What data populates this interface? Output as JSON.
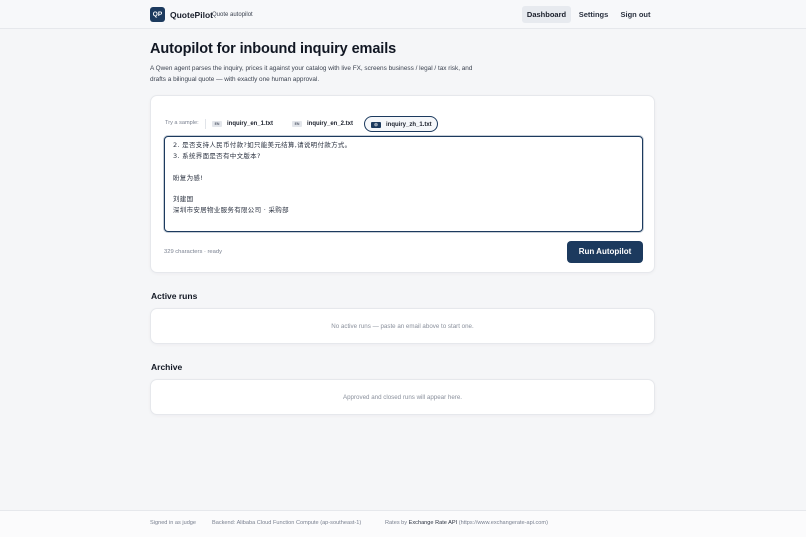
{
  "header": {
    "logo_text": "QP",
    "brand": "QuotePilot",
    "brand_sub": "Quote autopilot",
    "nav": [
      "Dashboard",
      "Settings",
      "Sign out"
    ]
  },
  "hero": {
    "title": "Autopilot for inbound inquiry emails",
    "description": "A Qwen agent parses the inquiry, prices it against your catalog with live FX, screens business / legal / tax risk, and drafts a bilingual quote — with exactly one human approval."
  },
  "composer": {
    "try_label": "Try a sample:",
    "samples": [
      {
        "flag": "EN",
        "name": "inquiry_en_1.txt"
      },
      {
        "flag": "EN",
        "name": "inquiry_en_2.txt"
      },
      {
        "flag": "中",
        "name": "inquiry_zh_1.txt"
      }
    ],
    "editor_lines": [
      "2. 是否支持人民币付款?如只能美元结算,请说明付款方式。",
      "3. 系统界面是否有中文版本?",
      "盼复为感!",
      "刘建国",
      "深圳市安居物业服务有限公司 · 采购部"
    ],
    "char_count": "329 characters · ready",
    "run_label": "Run Autopilot"
  },
  "active": {
    "title": "Active runs",
    "empty": "No active runs — paste an email above to start one."
  },
  "archive": {
    "title": "Archive",
    "empty": "Approved and closed runs will appear here."
  },
  "footer": {
    "signed_in": "Signed in as judge",
    "backend": "Backend: Alibaba Cloud Function Compute (ap-southeast-1)",
    "rates_prefix": "Rates by",
    "rates_source": "Exchange Rate API",
    "rates_url": "(https://www.exchangerate-api.com)"
  },
  "colors": {
    "accent": "#1c3a5e",
    "background": "#f5f6f8"
  }
}
